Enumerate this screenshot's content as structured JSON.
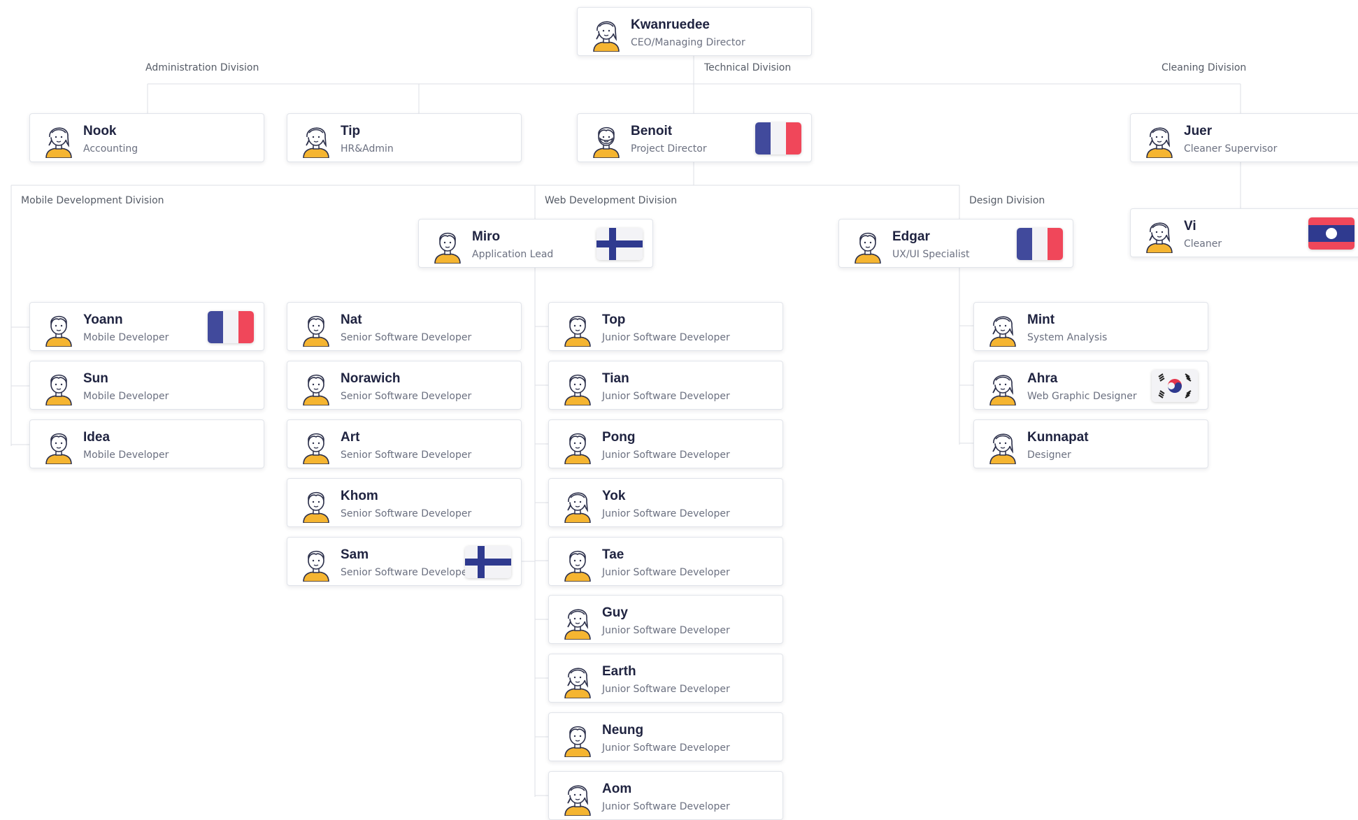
{
  "divisions": {
    "administration": "Administration Division",
    "technical": "Technical Division",
    "cleaning": "Cleaning Division",
    "mobile": "Mobile Development Division",
    "web": "Web Development Division",
    "design": "Design Division"
  },
  "people": {
    "ceo": {
      "name": "Kwanruedee",
      "role": "CEO/Managing Director",
      "avatar": "female-avatar-icon"
    },
    "nook": {
      "name": "Nook",
      "role": "Accounting",
      "avatar": "female-avatar-icon"
    },
    "tip": {
      "name": "Tip",
      "role": "HR&Admin",
      "avatar": "female-avatar-icon"
    },
    "benoit": {
      "name": "Benoit",
      "role": "Project Director",
      "avatar": "bearded-male-avatar-icon",
      "flag": "france-flag-icon"
    },
    "juer": {
      "name": "Juer",
      "role": "Cleaner Supervisor",
      "avatar": "female-avatar-icon"
    },
    "vi": {
      "name": "Vi",
      "role": "Cleaner",
      "avatar": "female-avatar-icon",
      "flag": "laos-flag-icon"
    },
    "miro": {
      "name": "Miro",
      "role": "Application Lead",
      "avatar": "male-avatar-icon",
      "flag": "finland-flag-icon"
    },
    "edgar": {
      "name": "Edgar",
      "role": "UX/UI Specialist",
      "avatar": "male-avatar-icon",
      "flag": "france-flag-icon"
    },
    "yoann": {
      "name": "Yoann",
      "role": "Mobile Developer",
      "avatar": "male-avatar-icon",
      "flag": "france-flag-icon"
    },
    "sun": {
      "name": "Sun",
      "role": "Mobile Developer",
      "avatar": "male-avatar-icon"
    },
    "idea": {
      "name": "Idea",
      "role": "Mobile Developer",
      "avatar": "male-avatar-icon"
    },
    "nat": {
      "name": "Nat",
      "role": "Senior Software Developer",
      "avatar": "male-avatar-icon"
    },
    "norawich": {
      "name": "Norawich",
      "role": "Senior Software Developer",
      "avatar": "male-avatar-icon"
    },
    "art": {
      "name": "Art",
      "role": "Senior Software Developer",
      "avatar": "male-avatar-icon"
    },
    "khom": {
      "name": "Khom",
      "role": "Senior Software Developer",
      "avatar": "male-avatar-icon"
    },
    "sam": {
      "name": "Sam",
      "role": "Senior Software Developer",
      "avatar": "male-avatar-icon",
      "flag": "finland-flag-icon"
    },
    "top": {
      "name": "Top",
      "role": "Junior Software Developer",
      "avatar": "male-avatar-icon"
    },
    "tian": {
      "name": "Tian",
      "role": "Junior Software Developer",
      "avatar": "male-avatar-icon"
    },
    "pong": {
      "name": "Pong",
      "role": "Junior Software Developer",
      "avatar": "male-avatar-icon"
    },
    "yok": {
      "name": "Yok",
      "role": "Junior Software Developer",
      "avatar": "female-avatar-icon"
    },
    "tae": {
      "name": "Tae",
      "role": "Junior Software Developer",
      "avatar": "male-avatar-icon"
    },
    "guy": {
      "name": "Guy",
      "role": "Junior Software Developer",
      "avatar": "female-avatar-icon"
    },
    "earth": {
      "name": "Earth",
      "role": "Junior Software Developer",
      "avatar": "female-avatar-icon"
    },
    "neung": {
      "name": "Neung",
      "role": "Junior Software Developer",
      "avatar": "male-avatar-icon"
    },
    "aom": {
      "name": "Aom",
      "role": "Junior Software Developer",
      "avatar": "female-avatar-icon"
    },
    "mint": {
      "name": "Mint",
      "role": "System Analysis",
      "avatar": "female-avatar-icon"
    },
    "ahra": {
      "name": "Ahra",
      "role": "Web Graphic Designer",
      "avatar": "female-avatar-icon",
      "flag": "south-korea-flag-icon"
    },
    "kunnapat": {
      "name": "Kunnapat",
      "role": "Designer",
      "avatar": "female-avatar-icon"
    }
  }
}
